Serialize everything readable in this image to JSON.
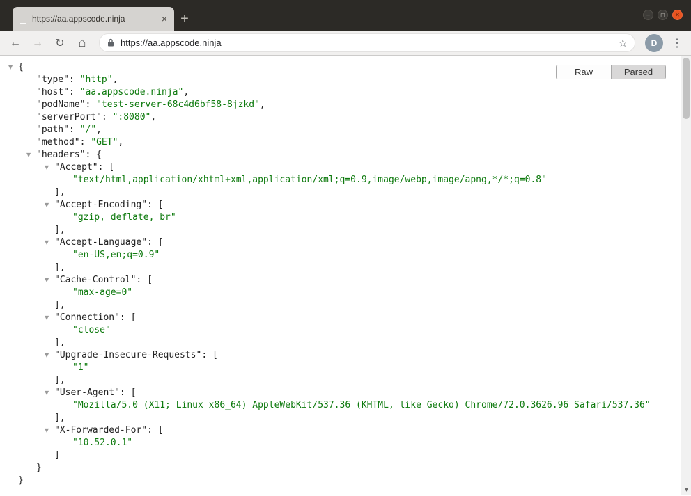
{
  "colors": {
    "key_text": "#232323",
    "string_value": "#0e7a0e",
    "toggle": "#9a9a9a",
    "titlebar_bg": "#2c2a26",
    "tab_bg": "#d5d3d0",
    "toolbar_bg": "#f1f0ef",
    "close_button": "#e95420",
    "selected_button_bg": "#d9d8d8"
  },
  "window": {
    "tab_title": "https://aa.appscode.ninja",
    "controls": {
      "minimize": "–",
      "maximize": "◻",
      "close": "✕"
    }
  },
  "icons": {
    "plus_glyph": "+",
    "tab_close_glyph": "×",
    "back_glyph": "←",
    "forward_glyph": "→",
    "reload_glyph": "↻",
    "home_glyph": "⌂",
    "star_glyph": "☆",
    "menu_glyph": "⋮",
    "scroll_down_glyph": "▼",
    "toggle_glyph": "▼"
  },
  "toolbar": {
    "url": "https://aa.appscode.ninja",
    "avatar_letter": "D"
  },
  "viewer_controls": {
    "raw_label": "Raw",
    "parsed_label": "Parsed",
    "selected": "Parsed"
  },
  "json_lines": [
    {
      "indent": 0,
      "toggle": true,
      "key": null,
      "value": null,
      "punct": "{"
    },
    {
      "indent": 1,
      "toggle": false,
      "key": "type",
      "value": "http",
      "punct": ","
    },
    {
      "indent": 1,
      "toggle": false,
      "key": "host",
      "value": "aa.appscode.ninja",
      "punct": ","
    },
    {
      "indent": 1,
      "toggle": false,
      "key": "podName",
      "value": "test-server-68c4d6bf58-8jzkd",
      "punct": ","
    },
    {
      "indent": 1,
      "toggle": false,
      "key": "serverPort",
      "value": ":8080",
      "punct": ","
    },
    {
      "indent": 1,
      "toggle": false,
      "key": "path",
      "value": "/",
      "punct": ","
    },
    {
      "indent": 1,
      "toggle": false,
      "key": "method",
      "value": "GET",
      "punct": ","
    },
    {
      "indent": 1,
      "toggle": true,
      "key": "headers",
      "value": null,
      "punct": "{"
    },
    {
      "indent": 2,
      "toggle": true,
      "key": "Accept",
      "value": null,
      "punct": "["
    },
    {
      "indent": 3,
      "toggle": false,
      "key": null,
      "value": "text/html,application/xhtml+xml,application/xml;q=0.9,image/webp,image/apng,*/*;q=0.8",
      "punct": ""
    },
    {
      "indent": 2,
      "toggle": false,
      "key": null,
      "value": null,
      "punct": "],"
    },
    {
      "indent": 2,
      "toggle": true,
      "key": "Accept-Encoding",
      "value": null,
      "punct": "["
    },
    {
      "indent": 3,
      "toggle": false,
      "key": null,
      "value": "gzip, deflate, br",
      "punct": ""
    },
    {
      "indent": 2,
      "toggle": false,
      "key": null,
      "value": null,
      "punct": "],"
    },
    {
      "indent": 2,
      "toggle": true,
      "key": "Accept-Language",
      "value": null,
      "punct": "["
    },
    {
      "indent": 3,
      "toggle": false,
      "key": null,
      "value": "en-US,en;q=0.9",
      "punct": ""
    },
    {
      "indent": 2,
      "toggle": false,
      "key": null,
      "value": null,
      "punct": "],"
    },
    {
      "indent": 2,
      "toggle": true,
      "key": "Cache-Control",
      "value": null,
      "punct": "["
    },
    {
      "indent": 3,
      "toggle": false,
      "key": null,
      "value": "max-age=0",
      "punct": ""
    },
    {
      "indent": 2,
      "toggle": false,
      "key": null,
      "value": null,
      "punct": "],"
    },
    {
      "indent": 2,
      "toggle": true,
      "key": "Connection",
      "value": null,
      "punct": "["
    },
    {
      "indent": 3,
      "toggle": false,
      "key": null,
      "value": "close",
      "punct": ""
    },
    {
      "indent": 2,
      "toggle": false,
      "key": null,
      "value": null,
      "punct": "],"
    },
    {
      "indent": 2,
      "toggle": true,
      "key": "Upgrade-Insecure-Requests",
      "value": null,
      "punct": "["
    },
    {
      "indent": 3,
      "toggle": false,
      "key": null,
      "value": "1",
      "punct": ""
    },
    {
      "indent": 2,
      "toggle": false,
      "key": null,
      "value": null,
      "punct": "],"
    },
    {
      "indent": 2,
      "toggle": true,
      "key": "User-Agent",
      "value": null,
      "punct": "["
    },
    {
      "indent": 3,
      "toggle": false,
      "key": null,
      "value": "Mozilla/5.0 (X11; Linux x86_64) AppleWebKit/537.36 (KHTML, like Gecko) Chrome/72.0.3626.96 Safari/537.36",
      "punct": ""
    },
    {
      "indent": 2,
      "toggle": false,
      "key": null,
      "value": null,
      "punct": "],"
    },
    {
      "indent": 2,
      "toggle": true,
      "key": "X-Forwarded-For",
      "value": null,
      "punct": "["
    },
    {
      "indent": 3,
      "toggle": false,
      "key": null,
      "value": "10.52.0.1",
      "punct": ""
    },
    {
      "indent": 2,
      "toggle": false,
      "key": null,
      "value": null,
      "punct": "]"
    },
    {
      "indent": 1,
      "toggle": false,
      "key": null,
      "value": null,
      "punct": "}"
    },
    {
      "indent": 0,
      "toggle": false,
      "key": null,
      "value": null,
      "punct": "}"
    }
  ]
}
